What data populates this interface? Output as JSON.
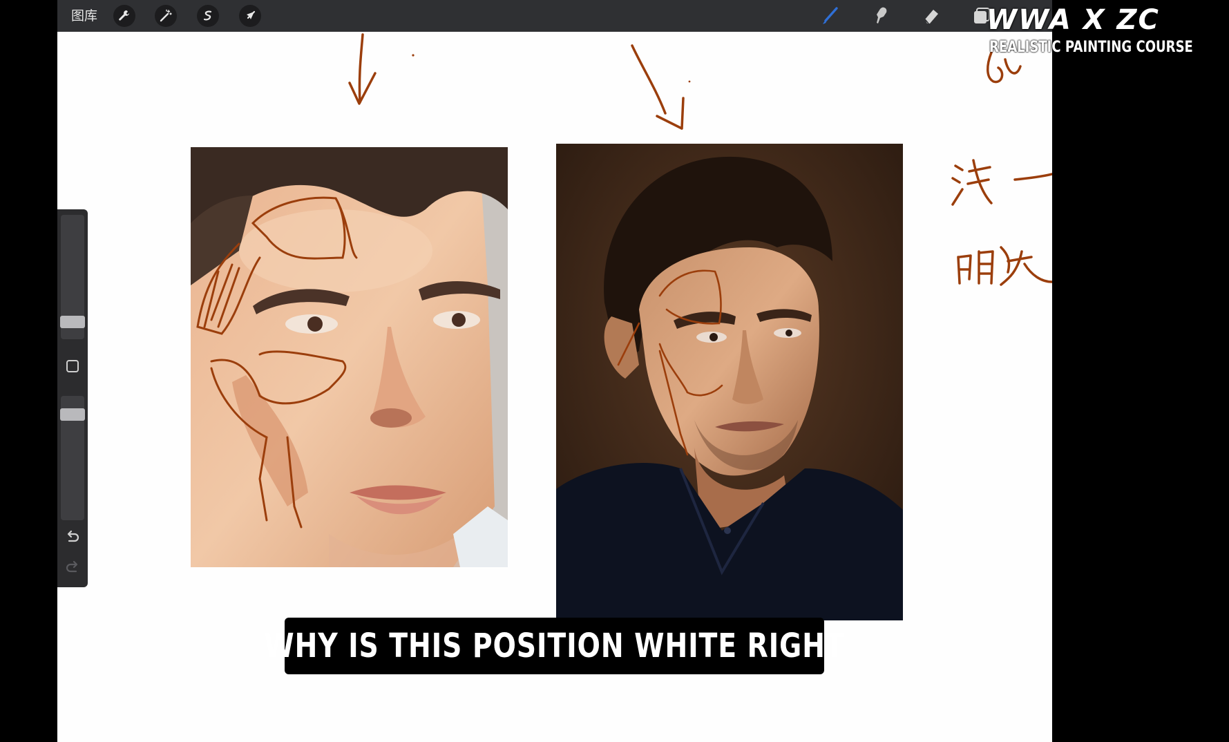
{
  "toolbar": {
    "gallery_label": "图库",
    "left_tools": [
      "wrench-icon",
      "magic-wand-icon",
      "selection-icon",
      "transform-arrow-icon"
    ],
    "right_tools": [
      "brush-icon",
      "smudge-icon",
      "eraser-icon",
      "layers-icon"
    ],
    "brush_color": "#2f6fd6"
  },
  "sidebar": {
    "size_level": 0.25,
    "opacity_level": 0.9,
    "icons": [
      "modify-square-icon",
      "undo-icon",
      "redo-icon"
    ]
  },
  "subtitle": {
    "text": "WHY IS THIS POSITION WHITE RIGHT"
  },
  "watermark": {
    "title": "WWA X ZC",
    "subtitle": "REALISTIC PAINTING COURSE"
  },
  "annotations": {
    "stroke_color": "#9b3e0c",
    "handwriting": [
      "浅一",
      "明暗"
    ]
  }
}
